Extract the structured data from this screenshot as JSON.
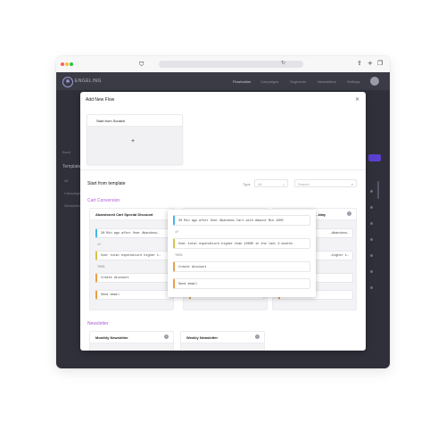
{
  "browser": {
    "url": ""
  },
  "app": {
    "brand": "ENGELING",
    "nav": [
      "Flowbuilder",
      "Campaigns",
      "Segments",
      "Newsletters",
      "Settings"
    ],
    "bg_side": [
      "Back",
      "Templates",
      "All",
      "Campaigns",
      "Newsletter"
    ]
  },
  "modal": {
    "title": "Add New Flow",
    "close": "×",
    "scratch_label": "Start from Scratch",
    "scratch_plus": "+",
    "section_title": "Start from template",
    "type_label": "Type",
    "type_value": "All",
    "search_placeholder": "Search",
    "categories": {
      "cart": "Cart Conversion",
      "newsletter": "Newsletter"
    },
    "cards": [
      {
        "title": "Abandoned Cart Special Discount",
        "steps": [
          "30 Min ago after User Abandonu…",
          "if",
          "User total expenditure higher t…",
          "THEN",
          "Create discount",
          "Send email"
        ]
      },
      {
        "title": "",
        "steps": [
          "",
          "",
          "",
          "",
          "Send email"
        ]
      },
      {
        "title": "…iday",
        "steps": [
          "…Abandonu…",
          "…higher t…"
        ]
      },
      {
        "title": "Monthly Newsletter",
        "steps": []
      },
      {
        "title": "Weekly Newsletter",
        "steps": []
      }
    ],
    "popup": {
      "steps": [
        "30 Min ago after User Abandons Cart with Amount Min 1000",
        "if",
        "User total expenditure higher than 10000 in the last 3 months",
        "THEN",
        "Create discount",
        "Send email"
      ]
    }
  },
  "colors": {
    "accent": "#5b3fd1",
    "category": "#b05bd8",
    "trigger": "#48b5e8",
    "condition": "#d8c24a",
    "action": "#e89f48"
  }
}
